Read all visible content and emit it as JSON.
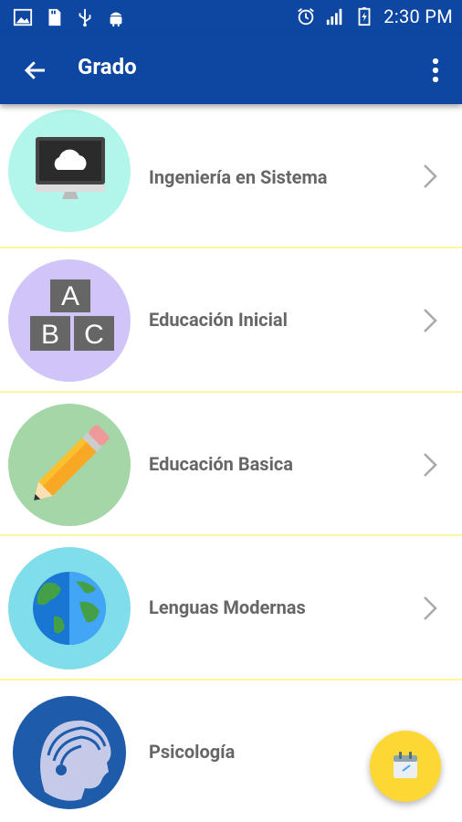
{
  "status_bar": {
    "time": "2:30 PM",
    "icons_left": [
      "image-icon",
      "sd-card-icon",
      "usb-icon",
      "android-icon"
    ],
    "icons_right": [
      "alarm-icon",
      "signal-icon",
      "battery-charging-icon"
    ]
  },
  "app_bar": {
    "title": "Grado",
    "back_icon": "arrow-back-icon",
    "menu_icon": "more-vert-icon",
    "color": "#0D47A1"
  },
  "degrees": [
    {
      "label": "Ingeniería en Sistema",
      "icon": "computer-cloud-icon",
      "bg": "#B2F5EA"
    },
    {
      "label": "Educación Inicial",
      "icon": "abc-blocks-icon",
      "bg": "#D1C4F9"
    },
    {
      "label": "Educación Basica",
      "icon": "pencil-icon",
      "bg": "#A5D6A7"
    },
    {
      "label": "Lenguas Modernas",
      "icon": "globe-icon",
      "bg": "#80DEEA"
    },
    {
      "label": "Psicología",
      "icon": "head-brain-icon",
      "bg": "#ffffff"
    }
  ],
  "fab": {
    "icon": "calendar-icon",
    "color": "#FDD835"
  },
  "divider_color": "#FFF59D"
}
